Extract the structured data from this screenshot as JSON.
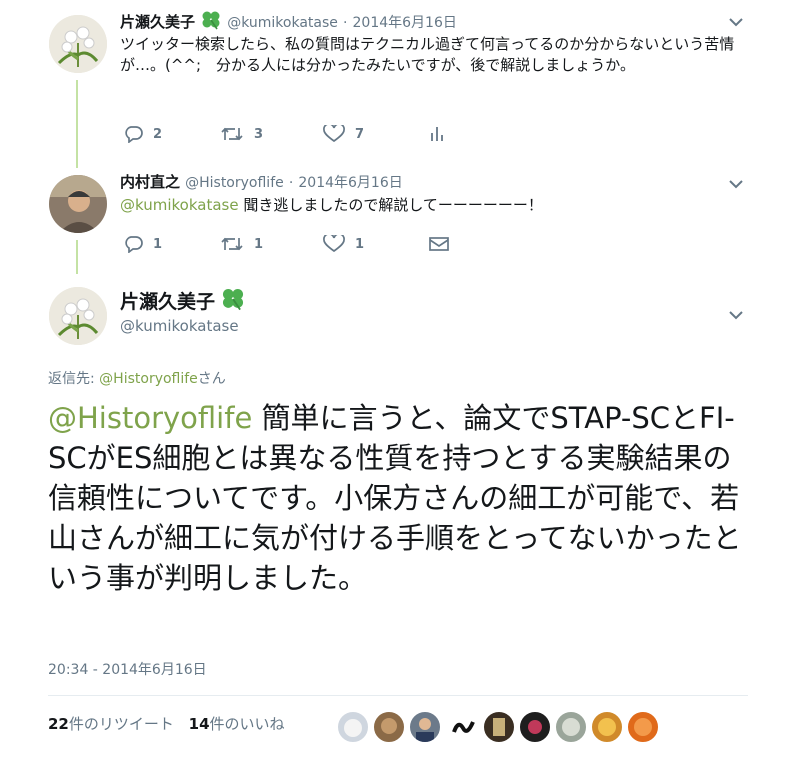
{
  "tweet1": {
    "name": "片瀬久美子",
    "handle": "@kumikokatase",
    "date": "2014年6月16日",
    "text": "ツイッター検索したら、私の質問はテクニカル過ぎて何言ってるのか分からないという苦情が…。(^^;　分かる人には分かったみたいですが、後で解説しましょうか。",
    "replies": "2",
    "retweets": "3",
    "likes": "7"
  },
  "tweet2": {
    "name": "内村直之",
    "handle": "@Historyoflife",
    "date": "2014年6月16日",
    "mention": "@kumikokatase",
    "text": " 聞き逃しましたので解説してーーーーーー！",
    "replies": "1",
    "retweets": "1",
    "likes": "1"
  },
  "main": {
    "name": "片瀬久美子",
    "handle": "@kumikokatase",
    "reply_to_label": "返信先:",
    "reply_to_handle": "@Historyoflife",
    "reply_to_suffix": "さん",
    "mention": "@Historyoflife",
    "text": " 簡単に言うと、論文でSTAP-SCとFI-SCがES細胞とは異なる性質を持つとする実験結果の信頼性についてです。小保方さんの細工が可能で、若山さんが細工に気が付ける手順をとってないかったという事が判明しました。",
    "timestamp": "20:34 - 2014年6月16日",
    "retweet_count": "22",
    "retweet_label": "件のリツイート",
    "like_count": "14",
    "like_label": "件のいいね"
  },
  "icons": {
    "reply": "reply-icon",
    "retweet": "retweet-icon",
    "like": "heart-icon",
    "analytics": "analytics-icon",
    "dm": "envelope-icon",
    "more": "chevron-down-icon",
    "clover": "clover-icon"
  },
  "colors": {
    "accent": "#7fa34b",
    "thread_line": "#c4e2a4",
    "muted": "#657786",
    "clover": "#4caf50"
  }
}
